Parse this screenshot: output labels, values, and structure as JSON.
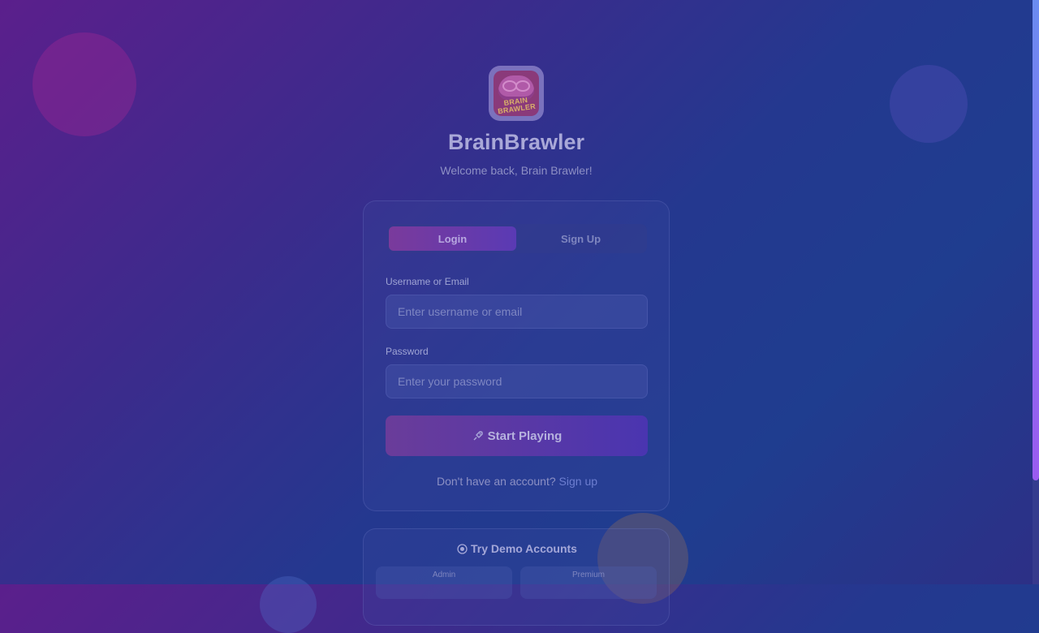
{
  "app": {
    "title": "BrainBrawler",
    "subtitle": "Welcome back, Brain Brawler!",
    "logo_text": "BRAIN BRAWLER"
  },
  "tabs": [
    {
      "label": "Login",
      "active": true
    },
    {
      "label": "Sign Up",
      "active": false
    }
  ],
  "form": {
    "username_label": "Username or Email",
    "username_placeholder": "Enter username or email",
    "password_label": "Password",
    "password_placeholder": "Enter your password",
    "submit_label": "Start Playing",
    "submit_icon": "rocket-icon",
    "switch_prompt": "Don't have an account?",
    "switch_link": "Sign up"
  },
  "demo": {
    "title": "Try Demo Accounts",
    "title_icon": "shield-icon",
    "accounts": [
      {
        "label": "Admin"
      },
      {
        "label": "Premium"
      }
    ]
  },
  "colors": {
    "accent_purple": "#6a3c9a",
    "accent_blue": "#4a35b0"
  }
}
